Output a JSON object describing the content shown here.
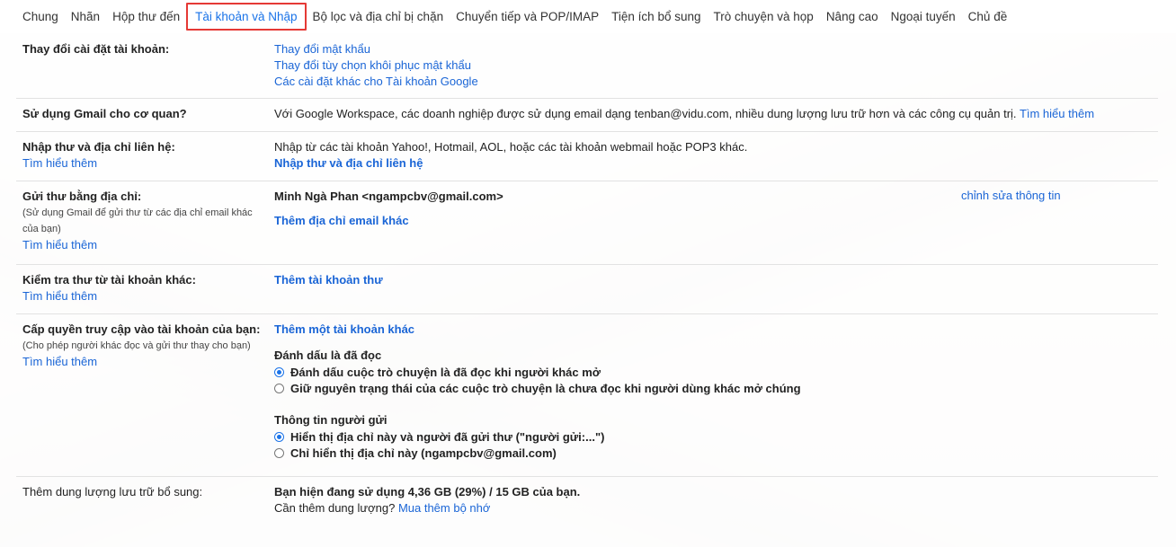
{
  "tabs": [
    {
      "label": "Chung"
    },
    {
      "label": "Nhãn"
    },
    {
      "label": "Hộp thư đến"
    },
    {
      "label": "Tài khoản và Nhập"
    },
    {
      "label": "Bộ lọc và địa chỉ bị chặn"
    },
    {
      "label": "Chuyển tiếp và POP/IMAP"
    },
    {
      "label": "Tiện ích bổ sung"
    },
    {
      "label": "Trò chuyện và họp"
    },
    {
      "label": "Nâng cao"
    },
    {
      "label": "Ngoại tuyến"
    },
    {
      "label": "Chủ đề"
    }
  ],
  "active_tab": "Tài khoản và Nhập",
  "sections": {
    "change_account": {
      "label": "Thay đổi cài đặt tài khoản:",
      "links": [
        "Thay đổi mật khẩu",
        "Thay đổi tùy chọn khôi phục mật khẩu",
        "Các cài đặt khác cho Tài khoản Google"
      ]
    },
    "workspace": {
      "label": "Sử dụng Gmail cho cơ quan?",
      "text": "Với Google Workspace, các doanh nghiệp được sử dụng email dạng tenban@vidu.com, nhiều dung lượng lưu trữ hơn và các công cụ quản trị.",
      "link": "Tìm hiểu thêm"
    },
    "import": {
      "label": "Nhập thư và địa chỉ liên hệ:",
      "learn": "Tìm hiểu thêm",
      "text": "Nhập từ các tài khoản Yahoo!, Hotmail, AOL, hoặc các tài khoản webmail hoặc POP3 khác.",
      "action": "Nhập thư và địa chỉ liên hệ"
    },
    "send_as": {
      "label": "Gửi thư bằng địa chỉ:",
      "sub": "(Sử dụng Gmail để gửi thư từ các địa chỉ email khác của bạn)",
      "learn": "Tìm hiểu thêm",
      "address": "Minh Ngà Phan <ngampcbv@gmail.com>",
      "edit": "chỉnh sửa thông tin",
      "add": "Thêm địa chỉ email khác"
    },
    "check_mail": {
      "label": "Kiểm tra thư từ tài khoản khác:",
      "learn": "Tìm hiểu thêm",
      "add": "Thêm tài khoản thư"
    },
    "grant": {
      "label": "Cấp quyền truy cập vào tài khoản của bạn:",
      "sub": "(Cho phép người khác đọc và gửi thư thay cho bạn)",
      "learn": "Tìm hiểu thêm",
      "add": "Thêm một tài khoản khác",
      "mark_heading": "Đánh dấu là đã đọc",
      "mark_options": [
        "Đánh dấu cuộc trò chuyện là đã đọc khi người khác mở",
        "Giữ nguyên trạng thái của các cuộc trò chuyện là chưa đọc khi người dùng khác mở chúng"
      ],
      "sender_heading": "Thông tin người gửi",
      "sender_options": [
        "Hiển thị địa chỉ này và người đã gửi thư (\"người gửi:...\")",
        "Chỉ hiển thị địa chỉ này (ngampcbv@gmail.com)"
      ]
    },
    "storage": {
      "label": "Thêm dung lượng lưu trữ bổ sung:",
      "usage": "Bạn hiện đang sử dụng 4,36 GB (29%) / 15 GB của bạn.",
      "need": "Cần thêm dung lượng?",
      "buy": "Mua thêm bộ nhớ"
    }
  },
  "colors": {
    "link": "#1a65d6",
    "active_tab": "#1a73e8",
    "highlight_box": "#e53935"
  }
}
